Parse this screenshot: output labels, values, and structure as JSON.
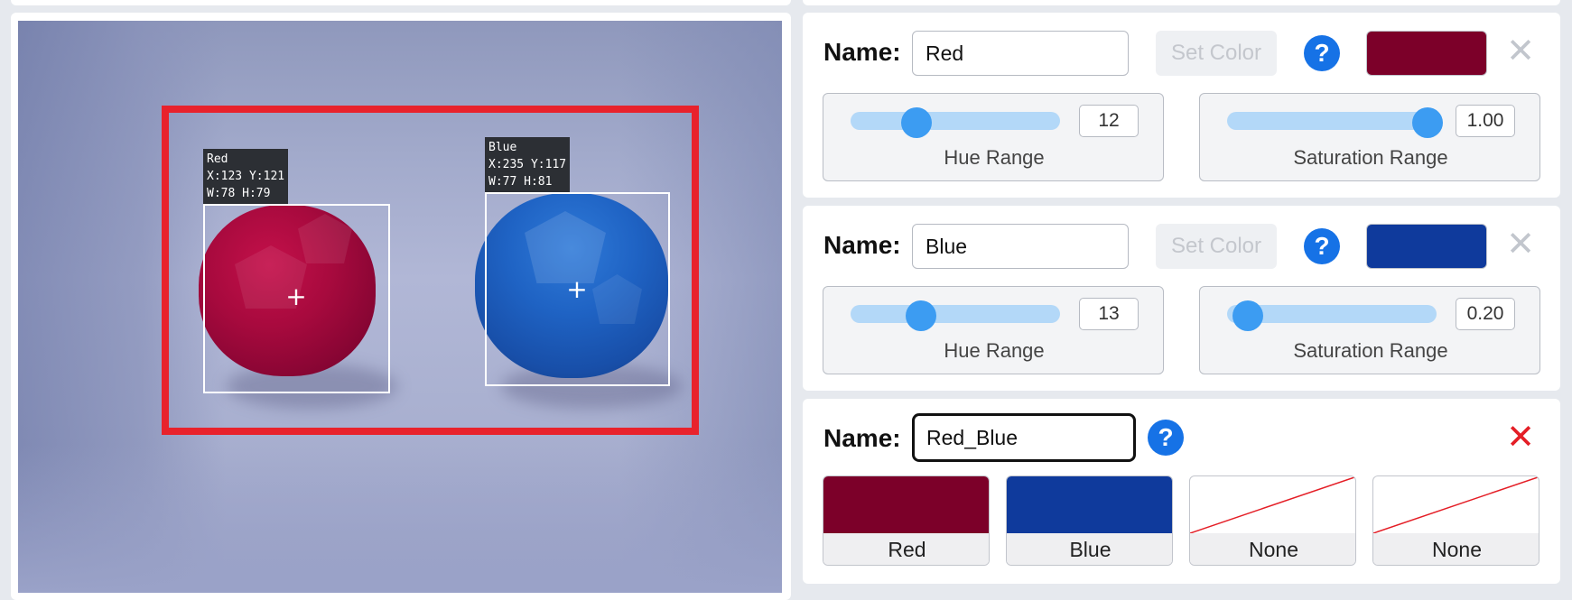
{
  "camera": {
    "detections": [
      {
        "name": "Red",
        "info": "Red\nX:123 Y:121\nW:78 H:79"
      },
      {
        "name": "Blue",
        "info": "Blue\nX:235 Y:117\nW:77 H:81"
      }
    ],
    "crosshair_glyph": "+",
    "roi_color": "#e8222c"
  },
  "cards": [
    {
      "name_label": "Name:",
      "name_value": "Red",
      "set_color_label": "Set Color",
      "help_glyph": "?",
      "close_glyph": "✕",
      "swatch_color": "#7c0029",
      "hue": {
        "value": "12",
        "caption": "Hue Range",
        "level": 0.31
      },
      "saturation": {
        "value": "1.00",
        "caption": "Saturation Range",
        "level": 0.93
      }
    },
    {
      "name_label": "Name:",
      "name_value": "Blue",
      "set_color_label": "Set Color",
      "help_glyph": "?",
      "close_glyph": "✕",
      "swatch_color": "#0f3a9c",
      "hue": {
        "value": "13",
        "caption": "Hue Range",
        "level": 0.33
      },
      "saturation": {
        "value": "0.20",
        "caption": "Saturation Range",
        "level": 0.17
      }
    }
  ],
  "combo": {
    "name_label": "Name:",
    "name_value": "Red_Blue",
    "help_glyph": "?",
    "close_glyph": "✕",
    "slots": [
      {
        "label": "Red",
        "color": "#7c0029"
      },
      {
        "label": "Blue",
        "color": "#0f3a9c"
      },
      {
        "label": "None",
        "color": ""
      },
      {
        "label": "None",
        "color": ""
      }
    ]
  }
}
